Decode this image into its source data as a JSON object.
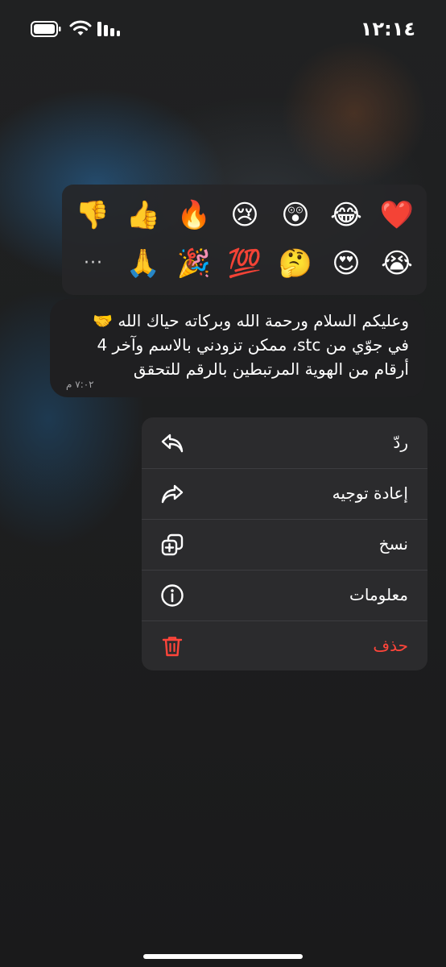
{
  "status_bar": {
    "time": "١٢:١٤"
  },
  "reactions": {
    "row1": [
      "❤️",
      "😂",
      "😲",
      "😢",
      "🔥",
      "👍",
      "👎"
    ],
    "row2": [
      "😭",
      "😍",
      "🤔",
      "💯",
      "🎉",
      "🙏"
    ],
    "more": "···"
  },
  "message": {
    "lines": [
      "وعليكم السلام ورحمة الله وبركاته حياك الله 🤝",
      "في جوّي من stc، ممكن تزودني بالاسم وآخر 4",
      "أرقام من الهوية المرتبطين بالرقم للتحقق"
    ],
    "time": "٧:٠٢ م"
  },
  "menu": {
    "items": [
      {
        "label": "ردّ",
        "icon": "reply-icon"
      },
      {
        "label": "إعادة توجيه",
        "icon": "forward-icon"
      },
      {
        "label": "نسخ",
        "icon": "copy-icon"
      },
      {
        "label": "معلومات",
        "icon": "info-icon"
      },
      {
        "label": "حذف",
        "icon": "trash-icon"
      }
    ]
  },
  "colors": {
    "danger": "#ff453a",
    "menu_bg": "#2c2c2e"
  }
}
